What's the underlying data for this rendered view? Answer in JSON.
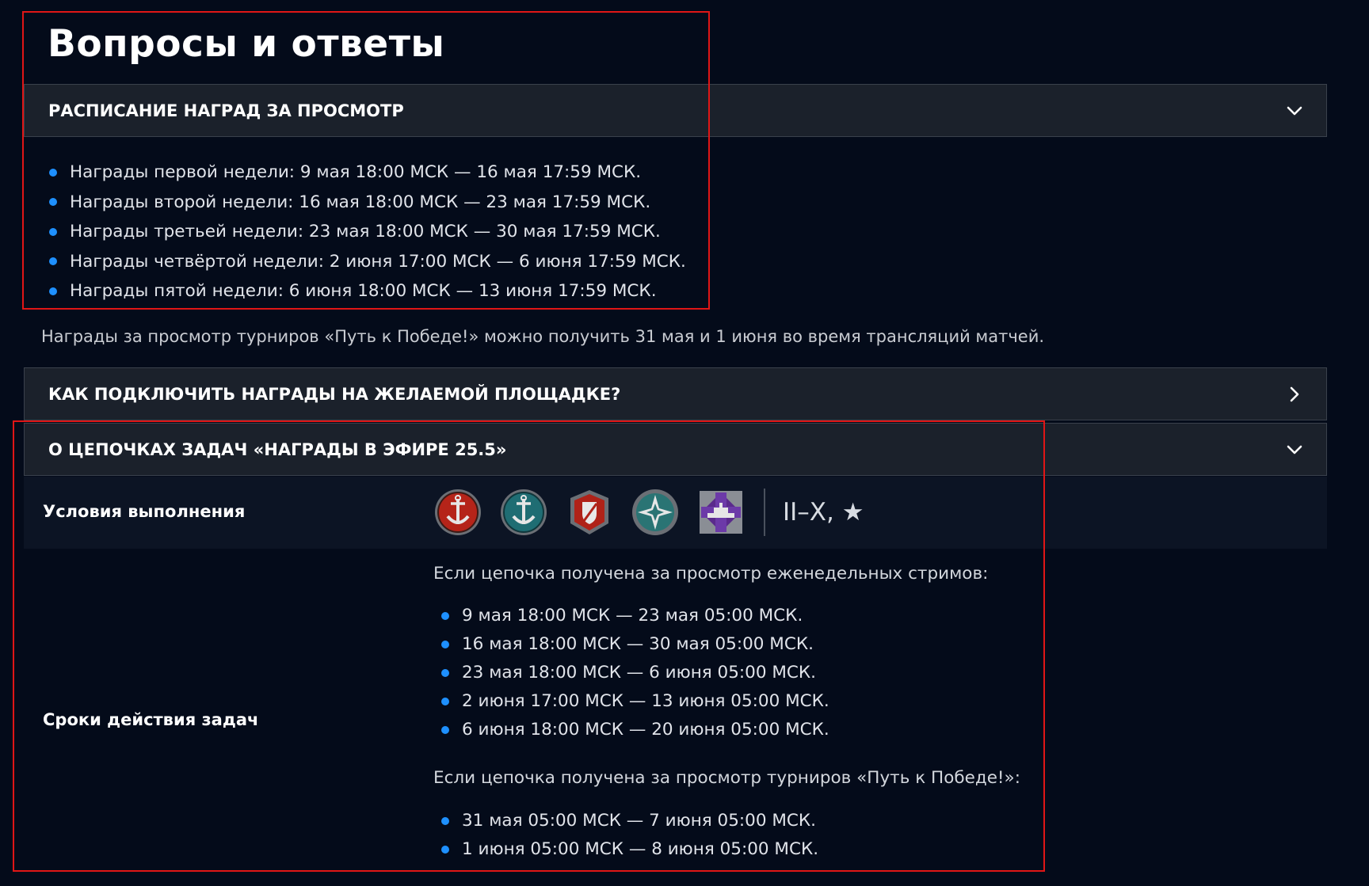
{
  "page": {
    "title": "Вопросы и ответы"
  },
  "sections": {
    "schedule": {
      "title": "РАСПИСАНИЕ НАГРАД ЗА ПРОСМОТР",
      "state_icon": "chevron-down-icon",
      "items": [
        "Награды первой недели: 9 мая 18:00 МСК — 16 мая 17:59 МСК.",
        "Награды второй недели: 16 мая 18:00 МСК — 23 мая 17:59 МСК.",
        "Награды третьей недели: 23 мая 18:00 МСК — 30 мая 17:59 МСК.",
        "Награды четвёртой недели: 2 июня 17:00 МСК — 6 июня 17:59 МСК.",
        "Награды пятой недели: 6 июня 18:00 МСК — 13 июня 17:59 МСК."
      ],
      "note": "Награды за просмотр турниров «Путь к Победе!» можно получить 31 мая и 1 июня во время трансляций матчей."
    },
    "connect": {
      "title": "КАК ПОДКЛЮЧИТЬ НАГРАДЫ НА ЖЕЛАЕМОЙ ПЛОЩАДКЕ?",
      "state_icon": "chevron-right-icon"
    },
    "chains": {
      "title": "О ЦЕПОЧКАХ ЗАДАЧ «НАГРАДЫ В ЭФИРЕ 25.5»",
      "state_icon": "chevron-down-icon",
      "conditions": {
        "label": "Условия выполнения",
        "badges": [
          "red-anchor-badge-icon",
          "teal-anchor-badge-icon",
          "red-shield-badge-icon",
          "teal-star-badge-icon",
          "purple-ship-badge-icon"
        ],
        "tiers": "II–X, ★"
      },
      "deadlines": {
        "label": "Сроки действия задач",
        "weekly_heading": "Если цепочка получена за просмотр еженедельных стримов:",
        "weekly": [
          "9 мая 18:00 МСК — 23 мая 05:00 МСК.",
          "16 мая 18:00 МСК — 30 мая 05:00 МСК.",
          "23 мая 18:00 МСК — 6 июня 05:00 МСК.",
          "2 июня 17:00 МСК — 13 июня 05:00 МСК.",
          "6 июня 18:00 МСК — 20 июня 05:00 МСК."
        ],
        "tournament_heading": "Если цепочка получена за просмотр турниров «Путь к Победе!»:",
        "tournament": [
          "31 мая 05:00 МСК — 7 июня 05:00 МСК.",
          "1 июня 05:00 МСК — 8 июня 05:00 МСК."
        ]
      }
    }
  },
  "colors": {
    "background": "#040b1a",
    "header_bg": "#1b212b",
    "bullet": "#1e90ff",
    "highlight_box": "#e01616"
  }
}
